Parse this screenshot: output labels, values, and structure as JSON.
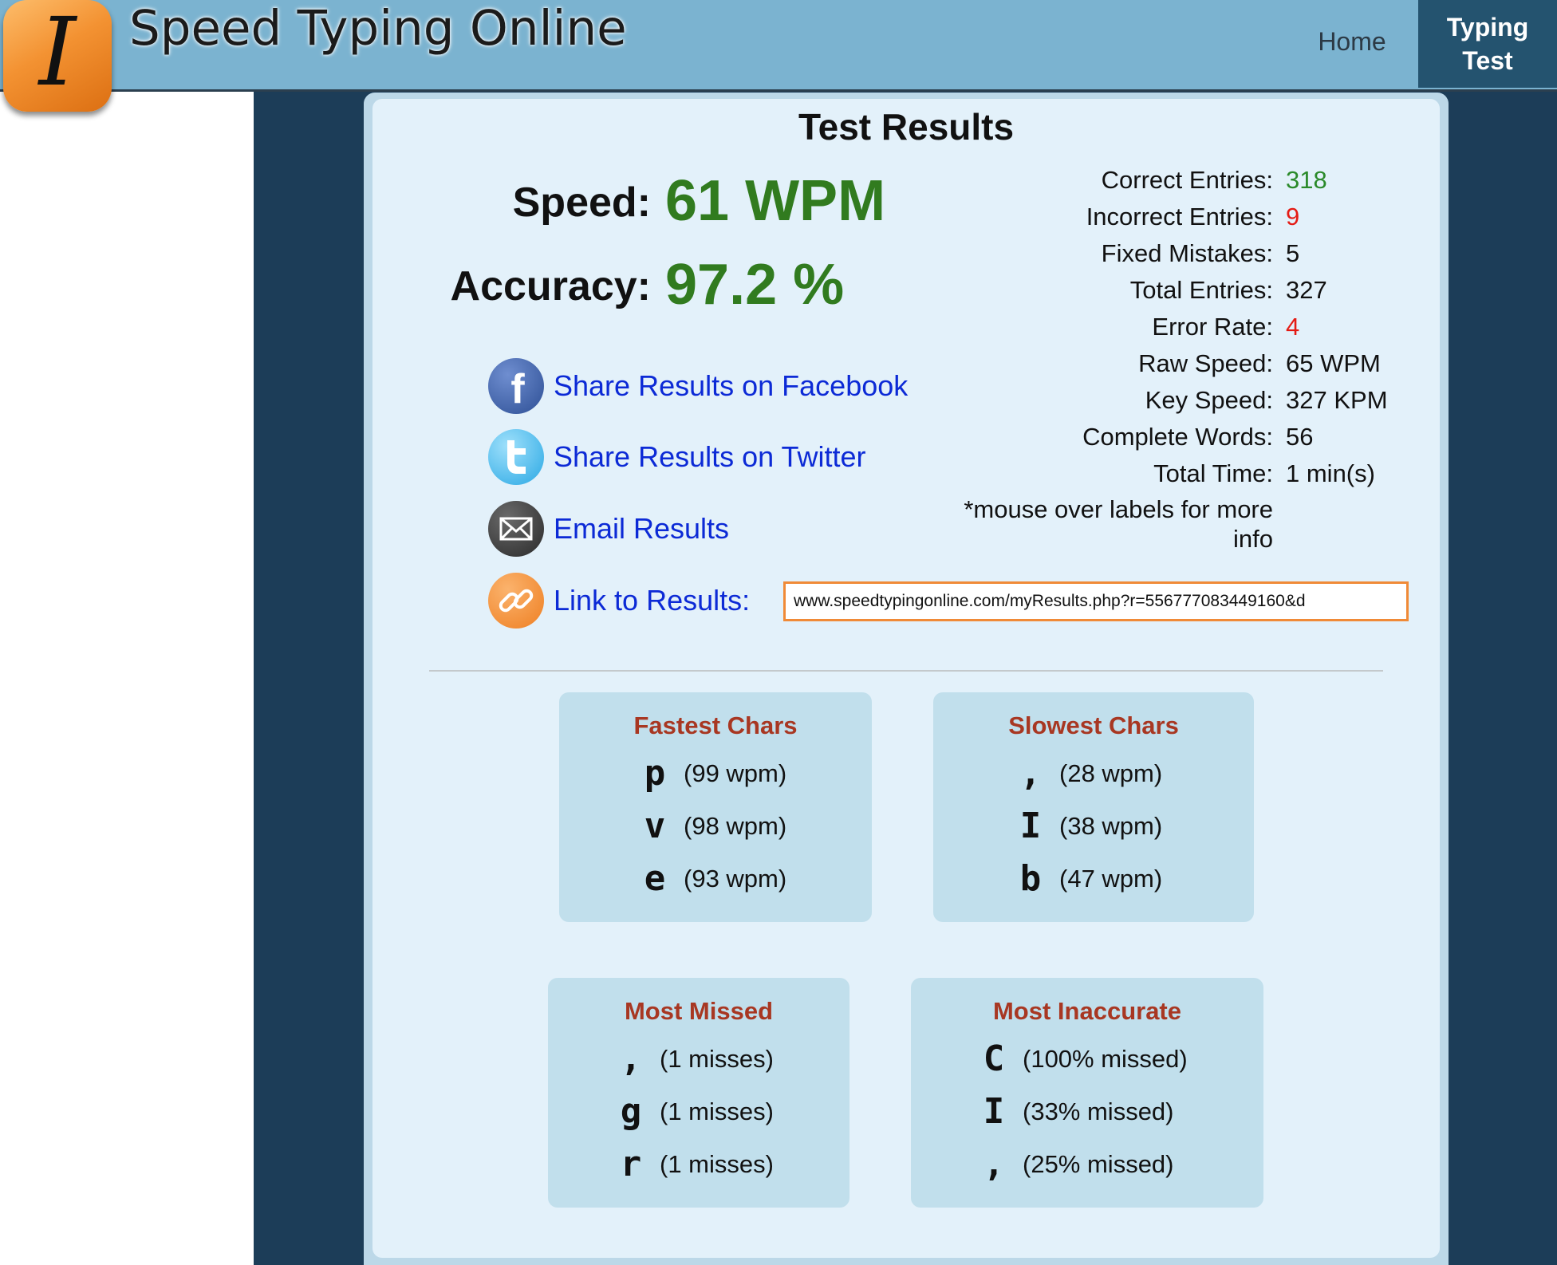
{
  "header": {
    "logo_glyph": "I",
    "site_title": "Speed Typing Online",
    "nav": {
      "home": "Home",
      "typing_test": "Typing Test"
    }
  },
  "results": {
    "title": "Test Results",
    "speed_label": "Speed:",
    "speed_value": "61 WPM",
    "accuracy_label": "Accuracy:",
    "accuracy_value": "97.2 %"
  },
  "share": {
    "facebook": "Share Results on Facebook",
    "twitter": "Share Results on Twitter",
    "email": "Email Results",
    "link_label": "Link to Results:",
    "link_url": "www.speedtypingonline.com/myResults.php?r=556777083449160&d"
  },
  "stats": [
    {
      "label": "Correct Entries:",
      "value": "318",
      "color": "green"
    },
    {
      "label": "Incorrect Entries:",
      "value": "9",
      "color": "red"
    },
    {
      "label": "Fixed Mistakes:",
      "value": "5",
      "color": "black"
    },
    {
      "label": "Total Entries:",
      "value": "327",
      "color": "black"
    },
    {
      "label": "Error Rate:",
      "value": "4",
      "color": "red"
    },
    {
      "label": "Raw Speed:",
      "value": "65 WPM",
      "color": "black"
    },
    {
      "label": "Key Speed:",
      "value": "327 KPM",
      "color": "black"
    },
    {
      "label": "Complete Words:",
      "value": "56",
      "color": "black"
    },
    {
      "label": "Total Time:",
      "value": "1 min(s)",
      "color": "black"
    }
  ],
  "mouse_note": "*mouse over labels for more info",
  "fastest": {
    "title": "Fastest Chars",
    "rows": [
      {
        "char": "p",
        "detail": "(99 wpm)"
      },
      {
        "char": "v",
        "detail": "(98 wpm)"
      },
      {
        "char": "e",
        "detail": "(93 wpm)"
      }
    ]
  },
  "slowest": {
    "title": "Slowest Chars",
    "rows": [
      {
        "char": ",",
        "detail": "(28 wpm)"
      },
      {
        "char": "I",
        "detail": "(38 wpm)"
      },
      {
        "char": "b",
        "detail": "(47 wpm)"
      }
    ]
  },
  "most_missed": {
    "title": "Most Missed",
    "rows": [
      {
        "char": ",",
        "detail": "(1 misses)"
      },
      {
        "char": "g",
        "detail": "(1 misses)"
      },
      {
        "char": "r",
        "detail": "(1 misses)"
      }
    ]
  },
  "most_inaccurate": {
    "title": "Most Inaccurate",
    "rows": [
      {
        "char": "C",
        "detail": "(100% missed)"
      },
      {
        "char": "I",
        "detail": "(33% missed)"
      },
      {
        "char": ",",
        "detail": "(25% missed)"
      }
    ]
  },
  "colors": {
    "header_bg": "#7bb3d0",
    "nav_active_bg": "#24536f",
    "page_dark_bg": "#1c3d58",
    "card_bg": "#e3f1fa",
    "accent_green": "#317b1f",
    "error_red": "#e41b14",
    "link_blue": "#0c2ad6",
    "box_title": "#a83722",
    "logo_orange": "#f39232"
  },
  "icons": [
    "facebook-icon",
    "twitter-icon",
    "email-icon",
    "link-icon"
  ]
}
